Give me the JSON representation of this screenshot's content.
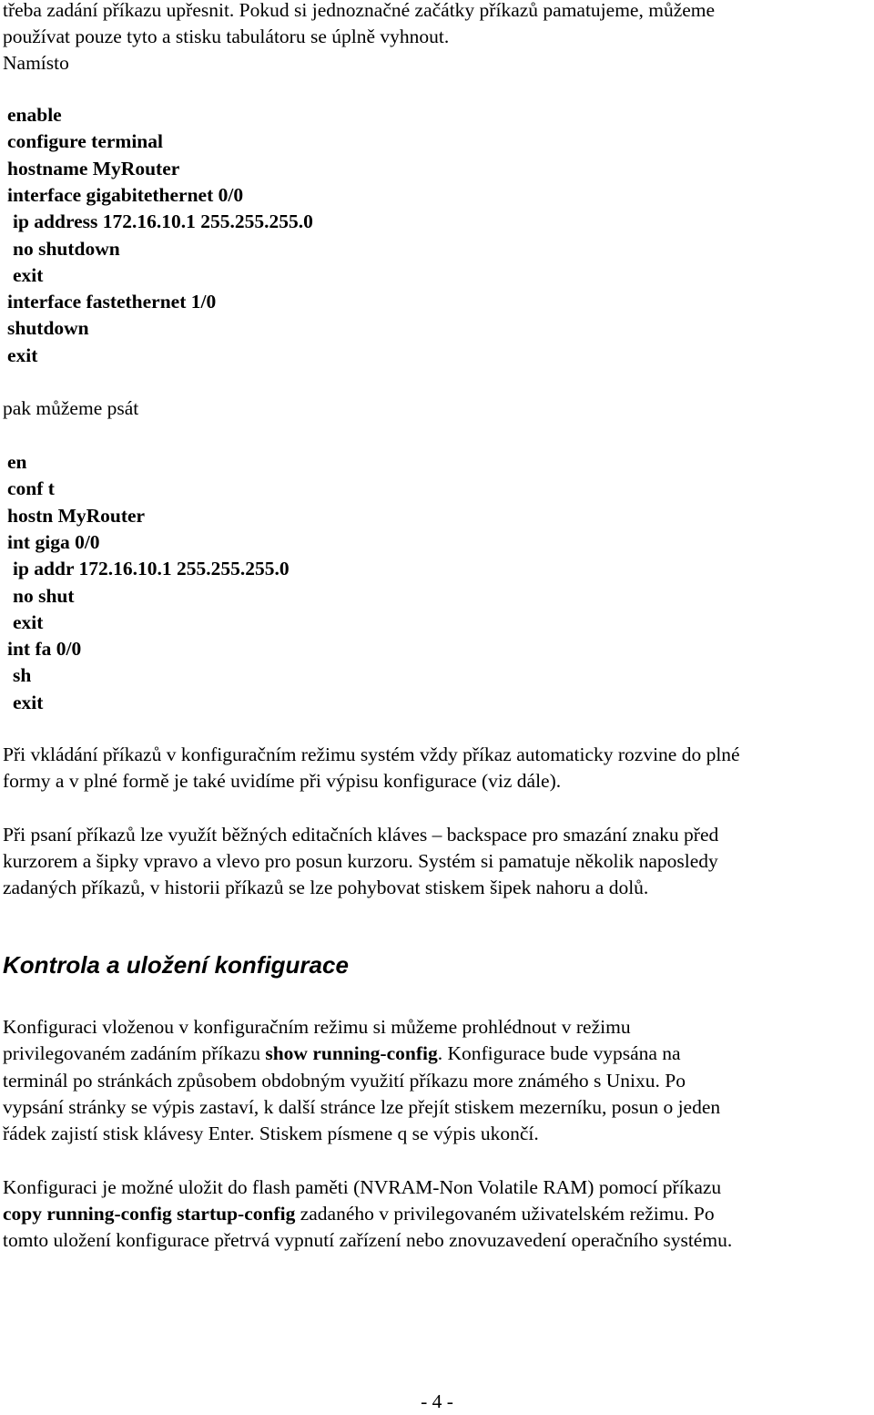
{
  "intro": {
    "lines": [
      "třeba zadání příkazu upřesnit. Pokud si jednoznačné začátky příkazů pamatujeme, můžeme",
      "používat pouze tyto a stisku tabulátoru se úplně vyhnout.",
      "Namísto"
    ]
  },
  "full_commands": [
    {
      "text": "enable",
      "indent": false
    },
    {
      "text": "configure terminal",
      "indent": false
    },
    {
      "text": "hostname MyRouter",
      "indent": false
    },
    {
      "text": "interface gigabitethernet 0/0",
      "indent": false
    },
    {
      "text": "ip address 172.16.10.1 255.255.255.0",
      "indent": true
    },
    {
      "text": "no shutdown",
      "indent": true
    },
    {
      "text": "exit",
      "indent": true
    },
    {
      "text": "interface fastethernet 1/0",
      "indent": false
    },
    {
      "text": "shutdown",
      "indent": false
    },
    {
      "text": "exit",
      "indent": false
    }
  ],
  "middle_text": "pak můžeme psát",
  "short_commands": [
    {
      "text": "en",
      "indent": false
    },
    {
      "text": "conf t",
      "indent": false
    },
    {
      "text": "hostn MyRouter",
      "indent": false
    },
    {
      "text": "int giga 0/0",
      "indent": false
    },
    {
      "text": "ip addr 172.16.10.1 255.255.255.0",
      "indent": true
    },
    {
      "text": "no shut",
      "indent": true
    },
    {
      "text": "exit",
      "indent": true
    },
    {
      "text": "int fa 0/0",
      "indent": false
    },
    {
      "text": "sh",
      "indent": true
    },
    {
      "text": "exit",
      "indent": true
    }
  ],
  "paragraphs": {
    "expansion": [
      "Při vkládání příkazů v konfiguračním režimu systém vždy příkaz automaticky rozvine do plné",
      "formy a v plné formě je také uvidíme při výpisu konfigurace (viz dále)."
    ],
    "editing": [
      "Při psaní příkazů lze využít běžných editačních kláves – backspace pro smazání znaku před",
      "kurzorem a šipky vpravo a vlevo pro posun kurzoru. Systém si pamatuje několik naposledy",
      "zadaných příkazů, v historii příkazů se lze pohybovat stiskem šipek nahoru a dolů."
    ]
  },
  "section": {
    "heading": "Kontrola a uložení konfigurace",
    "p1": {
      "l1": "Konfiguraci vloženou v konfiguračním režimu si můžeme prohlédnout v režimu",
      "l2_pre": "privilegovaném zadáním  příkazu ",
      "l2_bold": "show running-config",
      "l2_post": ". Konfigurace bude vypsána na",
      "l3": "terminál po stránkách způsobem obdobným využití příkazu more známého s Unixu.  Po",
      "l4": "vypsání stránky se výpis zastaví, k další stránce lze přejít stiskem mezerníku, posun o jeden",
      "l5": "řádek zajistí stisk klávesy Enter. Stiskem písmene q se výpis ukončí."
    },
    "p2": {
      "l1": "Konfiguraci je možné uložit do flash paměti (NVRAM-Non Volatile RAM) pomocí příkazu",
      "l2_bold": "copy running-config startup-config",
      "l2_post": " zadaného v privilegovaném uživatelském režimu. Po",
      "l3": "tomto uložení konfigurace přetrvá vypnutí zařízení nebo znovuzavedení operačního systému."
    }
  },
  "footer": {
    "page_number": "- 4 -"
  }
}
